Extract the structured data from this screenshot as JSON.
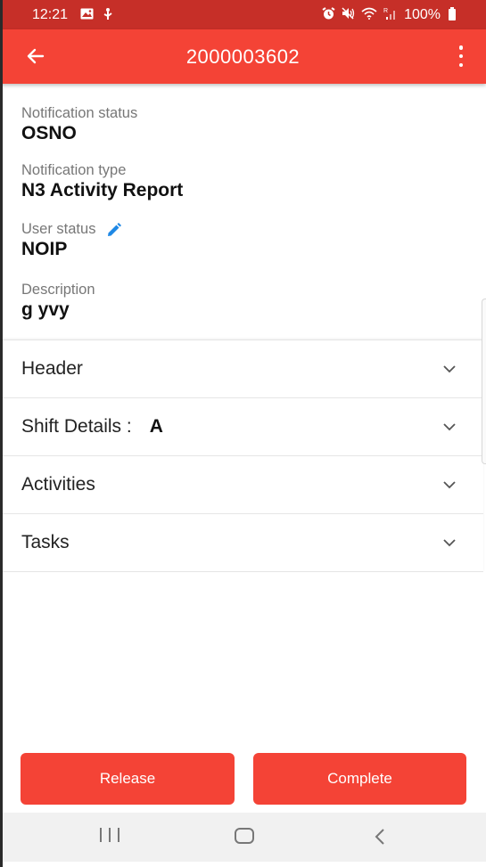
{
  "status_bar": {
    "time": "12:21",
    "left_icons": [
      "image-icon",
      "usb-debug-icon"
    ],
    "right_icons": [
      "alarm-icon",
      "mute-icon",
      "wifi-icon",
      "signal-roaming-icon"
    ],
    "battery": "100%"
  },
  "app_bar": {
    "title": "2000003602",
    "back_icon": "arrow-back-icon",
    "menu_icon": "more-vert-icon"
  },
  "fields": [
    {
      "label": "Notification status",
      "value": "OSNO"
    },
    {
      "label": "Notification type",
      "value": "N3 Activity Report"
    },
    {
      "label": "User status",
      "value": "NOIP",
      "editable": true
    },
    {
      "label": "Description",
      "value": "g yvy"
    }
  ],
  "sections": [
    {
      "label": "Header",
      "value": ""
    },
    {
      "label": "Shift Details :",
      "value": "A"
    },
    {
      "label": "Activities",
      "value": ""
    },
    {
      "label": "Tasks",
      "value": ""
    }
  ],
  "buttons": {
    "release": "Release",
    "complete": "Complete"
  },
  "colors": {
    "primary": "#f44336",
    "status_bar": "#c62f28",
    "edit_icon": "#1e88e5"
  }
}
